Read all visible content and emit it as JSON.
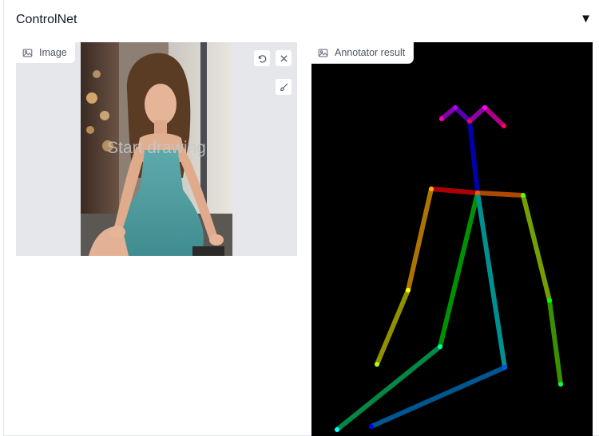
{
  "panel": {
    "title": "ControlNet",
    "toggle_icon": "triangle-down-icon"
  },
  "image_input": {
    "label": "Image",
    "overlay_text": "Start drawing",
    "tools": [
      "undo-icon",
      "close-icon",
      "brush-icon"
    ]
  },
  "annotator": {
    "label": "Annotator result",
    "colors": {
      "background": "#000000",
      "neck": "#0000cc",
      "right_shoulder": "#cc0000",
      "left_shoulder": "#cc5500"
    }
  }
}
